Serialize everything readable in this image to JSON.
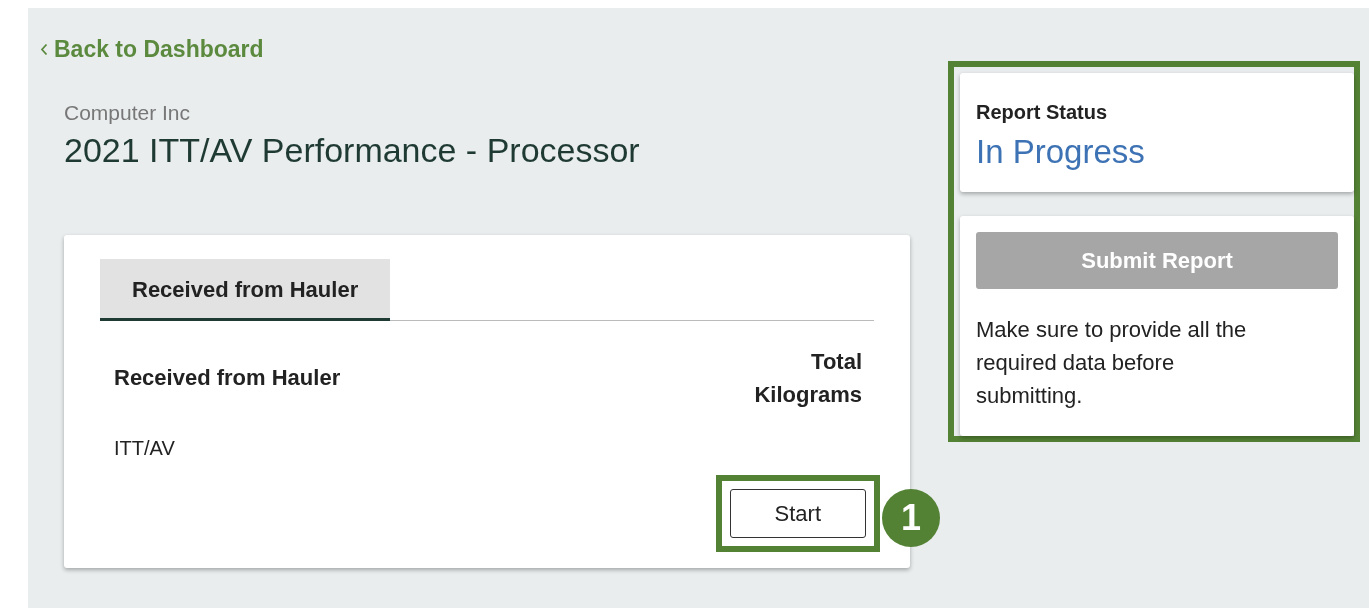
{
  "back_link": {
    "label": "Back to Dashboard"
  },
  "company": "Computer Inc",
  "title": "2021 ITT/AV Performance - Processor",
  "tabs": [
    {
      "label": "Received from Hauler",
      "selected": true
    }
  ],
  "table": {
    "columns": [
      "Received from Hauler",
      "Total Kilograms"
    ],
    "rows": [
      {
        "material": "ITT/AV"
      }
    ]
  },
  "start_button": {
    "label": "Start",
    "highlighted": true,
    "callout": "1"
  },
  "status_panel": {
    "highlighted": true,
    "heading": "Report Status",
    "status": "In Progress",
    "submit_button": {
      "label": "Submit Report",
      "disabled": true
    },
    "message": "Make sure to provide all the required data before submitting."
  }
}
